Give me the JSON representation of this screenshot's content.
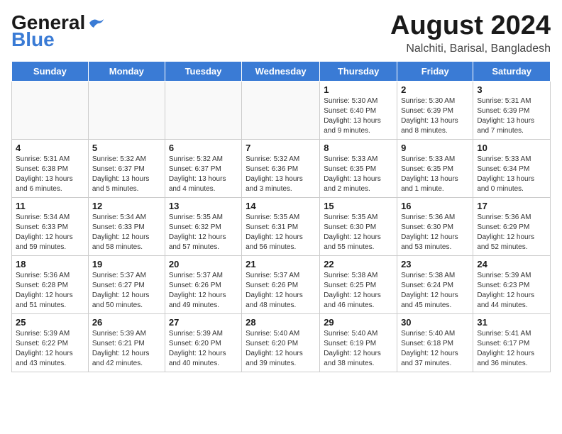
{
  "header": {
    "logo_line1": "General",
    "logo_line2": "Blue",
    "title": "August 2024",
    "subtitle": "Nalchiti, Barisal, Bangladesh"
  },
  "weekdays": [
    "Sunday",
    "Monday",
    "Tuesday",
    "Wednesday",
    "Thursday",
    "Friday",
    "Saturday"
  ],
  "weeks": [
    [
      {
        "day": "",
        "info": ""
      },
      {
        "day": "",
        "info": ""
      },
      {
        "day": "",
        "info": ""
      },
      {
        "day": "",
        "info": ""
      },
      {
        "day": "1",
        "info": "Sunrise: 5:30 AM\nSunset: 6:40 PM\nDaylight: 13 hours\nand 9 minutes."
      },
      {
        "day": "2",
        "info": "Sunrise: 5:30 AM\nSunset: 6:39 PM\nDaylight: 13 hours\nand 8 minutes."
      },
      {
        "day": "3",
        "info": "Sunrise: 5:31 AM\nSunset: 6:39 PM\nDaylight: 13 hours\nand 7 minutes."
      }
    ],
    [
      {
        "day": "4",
        "info": "Sunrise: 5:31 AM\nSunset: 6:38 PM\nDaylight: 13 hours\nand 6 minutes."
      },
      {
        "day": "5",
        "info": "Sunrise: 5:32 AM\nSunset: 6:37 PM\nDaylight: 13 hours\nand 5 minutes."
      },
      {
        "day": "6",
        "info": "Sunrise: 5:32 AM\nSunset: 6:37 PM\nDaylight: 13 hours\nand 4 minutes."
      },
      {
        "day": "7",
        "info": "Sunrise: 5:32 AM\nSunset: 6:36 PM\nDaylight: 13 hours\nand 3 minutes."
      },
      {
        "day": "8",
        "info": "Sunrise: 5:33 AM\nSunset: 6:35 PM\nDaylight: 13 hours\nand 2 minutes."
      },
      {
        "day": "9",
        "info": "Sunrise: 5:33 AM\nSunset: 6:35 PM\nDaylight: 13 hours\nand 1 minute."
      },
      {
        "day": "10",
        "info": "Sunrise: 5:33 AM\nSunset: 6:34 PM\nDaylight: 13 hours\nand 0 minutes."
      }
    ],
    [
      {
        "day": "11",
        "info": "Sunrise: 5:34 AM\nSunset: 6:33 PM\nDaylight: 12 hours\nand 59 minutes."
      },
      {
        "day": "12",
        "info": "Sunrise: 5:34 AM\nSunset: 6:33 PM\nDaylight: 12 hours\nand 58 minutes."
      },
      {
        "day": "13",
        "info": "Sunrise: 5:35 AM\nSunset: 6:32 PM\nDaylight: 12 hours\nand 57 minutes."
      },
      {
        "day": "14",
        "info": "Sunrise: 5:35 AM\nSunset: 6:31 PM\nDaylight: 12 hours\nand 56 minutes."
      },
      {
        "day": "15",
        "info": "Sunrise: 5:35 AM\nSunset: 6:30 PM\nDaylight: 12 hours\nand 55 minutes."
      },
      {
        "day": "16",
        "info": "Sunrise: 5:36 AM\nSunset: 6:30 PM\nDaylight: 12 hours\nand 53 minutes."
      },
      {
        "day": "17",
        "info": "Sunrise: 5:36 AM\nSunset: 6:29 PM\nDaylight: 12 hours\nand 52 minutes."
      }
    ],
    [
      {
        "day": "18",
        "info": "Sunrise: 5:36 AM\nSunset: 6:28 PM\nDaylight: 12 hours\nand 51 minutes."
      },
      {
        "day": "19",
        "info": "Sunrise: 5:37 AM\nSunset: 6:27 PM\nDaylight: 12 hours\nand 50 minutes."
      },
      {
        "day": "20",
        "info": "Sunrise: 5:37 AM\nSunset: 6:26 PM\nDaylight: 12 hours\nand 49 minutes."
      },
      {
        "day": "21",
        "info": "Sunrise: 5:37 AM\nSunset: 6:26 PM\nDaylight: 12 hours\nand 48 minutes."
      },
      {
        "day": "22",
        "info": "Sunrise: 5:38 AM\nSunset: 6:25 PM\nDaylight: 12 hours\nand 46 minutes."
      },
      {
        "day": "23",
        "info": "Sunrise: 5:38 AM\nSunset: 6:24 PM\nDaylight: 12 hours\nand 45 minutes."
      },
      {
        "day": "24",
        "info": "Sunrise: 5:39 AM\nSunset: 6:23 PM\nDaylight: 12 hours\nand 44 minutes."
      }
    ],
    [
      {
        "day": "25",
        "info": "Sunrise: 5:39 AM\nSunset: 6:22 PM\nDaylight: 12 hours\nand 43 minutes."
      },
      {
        "day": "26",
        "info": "Sunrise: 5:39 AM\nSunset: 6:21 PM\nDaylight: 12 hours\nand 42 minutes."
      },
      {
        "day": "27",
        "info": "Sunrise: 5:39 AM\nSunset: 6:20 PM\nDaylight: 12 hours\nand 40 minutes."
      },
      {
        "day": "28",
        "info": "Sunrise: 5:40 AM\nSunset: 6:20 PM\nDaylight: 12 hours\nand 39 minutes."
      },
      {
        "day": "29",
        "info": "Sunrise: 5:40 AM\nSunset: 6:19 PM\nDaylight: 12 hours\nand 38 minutes."
      },
      {
        "day": "30",
        "info": "Sunrise: 5:40 AM\nSunset: 6:18 PM\nDaylight: 12 hours\nand 37 minutes."
      },
      {
        "day": "31",
        "info": "Sunrise: 5:41 AM\nSunset: 6:17 PM\nDaylight: 12 hours\nand 36 minutes."
      }
    ]
  ]
}
